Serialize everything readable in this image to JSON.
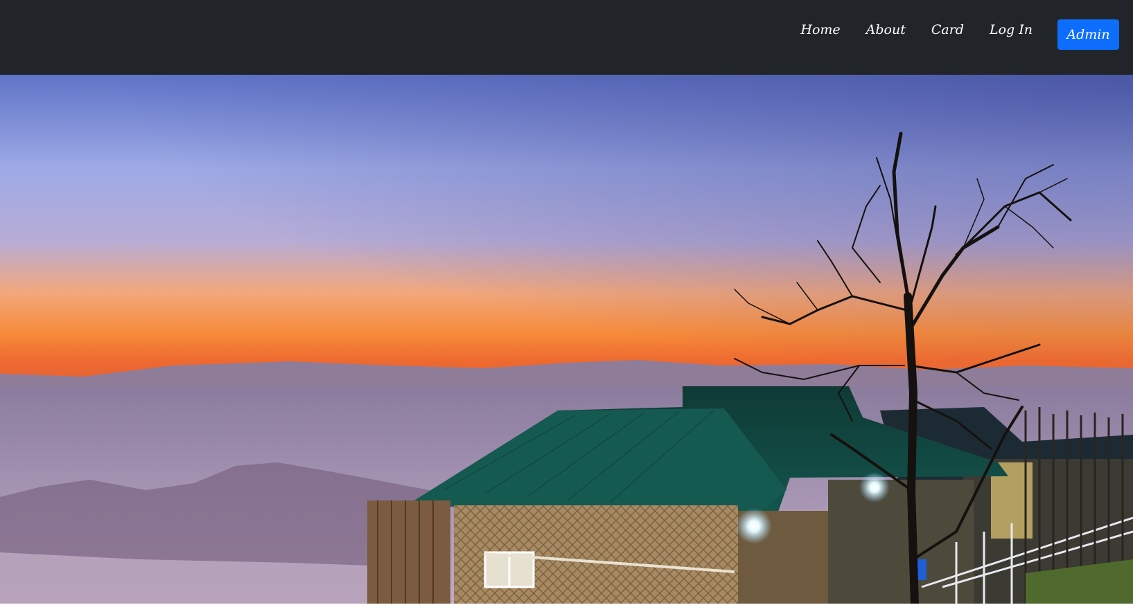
{
  "navbar": {
    "links": [
      {
        "label": "Home"
      },
      {
        "label": "About"
      },
      {
        "label": "Card"
      },
      {
        "label": "Log In"
      }
    ],
    "admin_label": "Admin"
  },
  "hero": {
    "scene": "sunset-over-misty-hills-with-hut-and-bare-tree"
  },
  "colors": {
    "navbar_bg": "#212529",
    "admin_btn": "#0d6efd"
  }
}
